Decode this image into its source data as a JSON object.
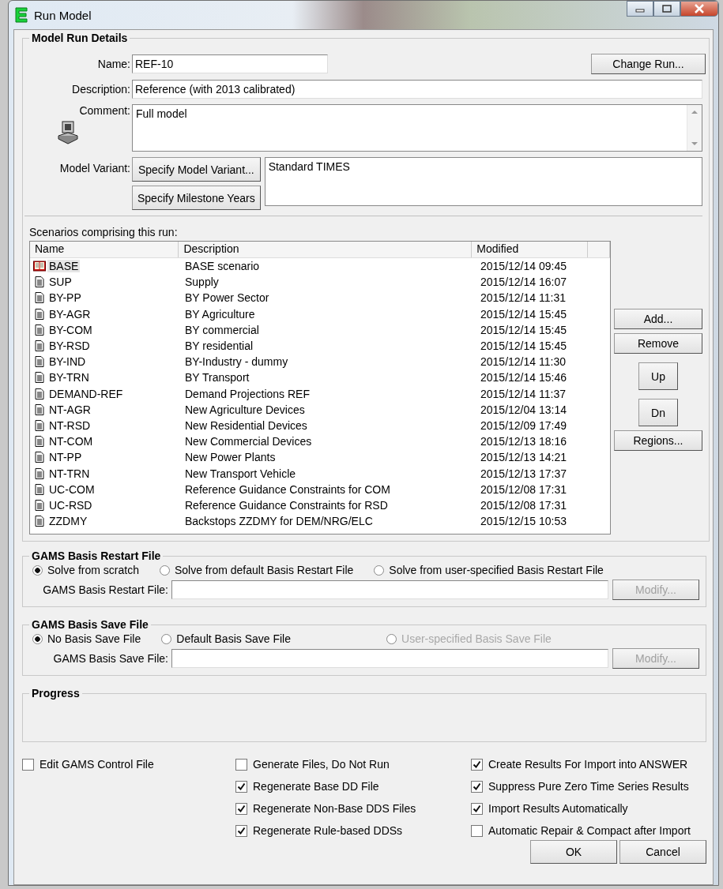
{
  "window": {
    "title": "Run Model"
  },
  "details": {
    "legend": "Model Run Details",
    "name_label": "Name:",
    "name": "REF-10",
    "change_run": "Change Run...",
    "description_label": "Description:",
    "description": "Reference (with 2013 calibrated)",
    "comment_label": "Comment:",
    "comment": "Full model",
    "variant_label": "Model Variant:",
    "specify_variant": "Specify Model Variant...",
    "specify_milestone": "Specify Milestone Years",
    "variant": "Standard TIMES"
  },
  "scenarios": {
    "label": "Scenarios comprising this run:",
    "columns": [
      "Name",
      "Description",
      "Modified"
    ],
    "rows": [
      {
        "name": "BASE",
        "description": "BASE scenario",
        "modified": "2015/12/14 09:45",
        "kind": "base",
        "selected": true
      },
      {
        "name": "SUP",
        "description": "Supply",
        "modified": "2015/12/14 16:07",
        "kind": "file",
        "selected": false
      },
      {
        "name": "BY-PP",
        "description": "BY Power Sector",
        "modified": "2015/12/14 11:31",
        "kind": "file",
        "selected": false
      },
      {
        "name": "BY-AGR",
        "description": "BY Agriculture",
        "modified": "2015/12/14 15:45",
        "kind": "file",
        "selected": false
      },
      {
        "name": "BY-COM",
        "description": "BY commercial",
        "modified": "2015/12/14 15:45",
        "kind": "file",
        "selected": false
      },
      {
        "name": "BY-RSD",
        "description": "BY residential",
        "modified": "2015/12/14 15:45",
        "kind": "file",
        "selected": false
      },
      {
        "name": "BY-IND",
        "description": "BY-Industry - dummy",
        "modified": "2015/12/14 11:30",
        "kind": "file",
        "selected": false
      },
      {
        "name": "BY-TRN",
        "description": "BY Transport",
        "modified": "2015/12/14 15:46",
        "kind": "file",
        "selected": false
      },
      {
        "name": "DEMAND-REF",
        "description": "Demand Projections REF",
        "modified": "2015/12/14 11:37",
        "kind": "file",
        "selected": false
      },
      {
        "name": "NT-AGR",
        "description": "New Agriculture Devices",
        "modified": "2015/12/04 13:14",
        "kind": "file",
        "selected": false
      },
      {
        "name": "NT-RSD",
        "description": "New Residential Devices",
        "modified": "2015/12/09 17:49",
        "kind": "file",
        "selected": false
      },
      {
        "name": "NT-COM",
        "description": "New Commercial Devices",
        "modified": "2015/12/13 18:16",
        "kind": "file",
        "selected": false
      },
      {
        "name": "NT-PP",
        "description": "New Power Plants",
        "modified": "2015/12/13 14:21",
        "kind": "file",
        "selected": false
      },
      {
        "name": "NT-TRN",
        "description": "New Transport Vehicle",
        "modified": "2015/12/13 17:37",
        "kind": "file",
        "selected": false
      },
      {
        "name": "UC-COM",
        "description": "Reference Guidance Constraints for COM",
        "modified": "2015/12/08 17:31",
        "kind": "file",
        "selected": false
      },
      {
        "name": "UC-RSD",
        "description": "Reference Guidance Constraints for RSD",
        "modified": "2015/12/08 17:31",
        "kind": "file",
        "selected": false
      },
      {
        "name": "ZZDMY",
        "description": "Backstops ZZDMY for DEM/NRG/ELC",
        "modified": "2015/12/15 10:53",
        "kind": "file",
        "selected": false
      }
    ],
    "buttons": {
      "add": "Add...",
      "remove": "Remove",
      "up": "Up",
      "down": "Dn",
      "regions": "Regions..."
    }
  },
  "restart": {
    "legend": "GAMS Basis Restart File",
    "options": [
      {
        "label": "Solve from scratch",
        "selected": true,
        "disabled": false
      },
      {
        "label": "Solve from default Basis Restart File",
        "selected": false,
        "disabled": false
      },
      {
        "label": "Solve from user-specified Basis Restart File",
        "selected": false,
        "disabled": false
      }
    ],
    "field_label": "GAMS Basis Restart File:",
    "modify": "Modify...",
    "modify_disabled": true
  },
  "save": {
    "legend": "GAMS Basis Save File",
    "options": [
      {
        "label": "No Basis Save File",
        "selected": true,
        "disabled": false
      },
      {
        "label": "Default Basis Save File",
        "selected": false,
        "disabled": false
      },
      {
        "label": "User-specified Basis Save File",
        "selected": false,
        "disabled": true
      }
    ],
    "field_label": "GAMS Basis Save File:",
    "modify": "Modify...",
    "modify_disabled": true
  },
  "progress": {
    "legend": "Progress"
  },
  "options": [
    [
      {
        "label": "Edit GAMS Control File",
        "checked": false
      }
    ],
    [
      {
        "label": "Generate Files, Do Not Run",
        "checked": false
      },
      {
        "label": "Regenerate Base DD File",
        "checked": true
      },
      {
        "label": "Regenerate Non-Base DDS Files",
        "checked": true
      },
      {
        "label": "Regenerate Rule-based DDSs",
        "checked": true
      }
    ],
    [
      {
        "label": "Create Results For Import into ANSWER",
        "checked": true
      },
      {
        "label": "Suppress Pure Zero Time Series Results",
        "checked": true
      },
      {
        "label": "Import Results Automatically",
        "checked": true
      },
      {
        "label": "Automatic Repair & Compact after Import",
        "checked": false
      }
    ]
  ],
  "buttons": {
    "ok": "OK",
    "cancel": "Cancel"
  }
}
